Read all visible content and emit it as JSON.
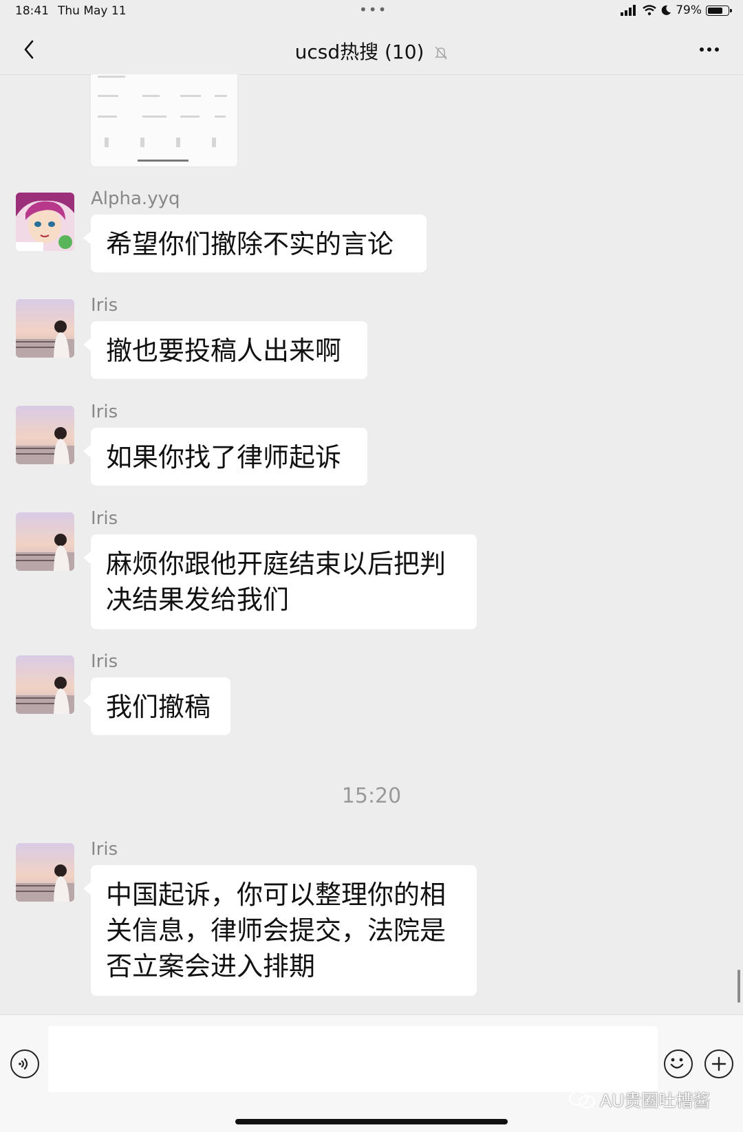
{
  "status_bar": {
    "time": "18:41",
    "date": "Thu May 11",
    "battery_text": "79%",
    "battery_level": 0.79
  },
  "nav": {
    "title": "ucsd热搜 (10)"
  },
  "messages": [
    {
      "sender": "Alpha.yyq",
      "lines": [
        "希望你们撤除不实的言论"
      ]
    },
    {
      "sender": "Iris",
      "lines": [
        "撤也要投稿人出来啊"
      ]
    },
    {
      "sender": "Iris",
      "lines": [
        "如果你找了律师起诉"
      ]
    },
    {
      "sender": "Iris",
      "lines": [
        "麻烦你跟他开庭结束以后把判",
        "决结果发给我们"
      ]
    },
    {
      "sender": "Iris",
      "lines": [
        "我们撤稿"
      ]
    },
    {
      "sender": "Iris",
      "lines": [
        "中国起诉，你可以整理你的相",
        "关信息，律师会提交，法院是",
        "否立案会进入排期"
      ]
    }
  ],
  "time_divider": "15:20",
  "watermark": "AU贵圈吐槽酱",
  "colors": {
    "background": "#ededed",
    "bubble": "#ffffff",
    "sender_text": "#888888"
  }
}
